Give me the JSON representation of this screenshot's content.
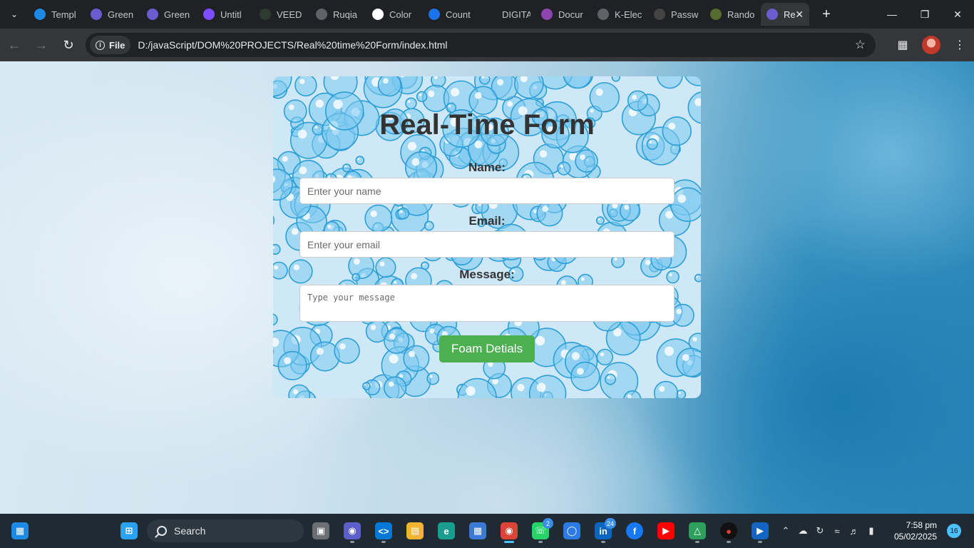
{
  "browser": {
    "tabs": [
      {
        "label": "Templ",
        "icon": "canva-icon",
        "color": "#1e88e5"
      },
      {
        "label": "Green",
        "icon": "doc-icon",
        "color": "#6d5bd0"
      },
      {
        "label": "Green",
        "icon": "doc-icon",
        "color": "#6d5bd0"
      },
      {
        "label": "Untitl",
        "icon": "app-icon",
        "color": "#7c4dff"
      },
      {
        "label": "VEED",
        "icon": "veed-icon",
        "color": "#2e3b2f"
      },
      {
        "label": "Ruqia",
        "icon": "globe-icon",
        "color": "#5f6368"
      },
      {
        "label": "Color",
        "icon": "color-icon",
        "color": "#ffffff"
      },
      {
        "label": "Count",
        "icon": "count-icon",
        "color": "#1a73e8"
      },
      {
        "label": "DIGITA",
        "icon": "terminal-icon",
        "color": "#202124"
      },
      {
        "label": "Docur",
        "icon": "doc-icon",
        "color": "#8e44ad"
      },
      {
        "label": "K-Elec",
        "icon": "globe-icon",
        "color": "#5f6368"
      },
      {
        "label": "Passw",
        "icon": "key-icon",
        "color": "#444"
      },
      {
        "label": "Rando",
        "icon": "image-icon",
        "color": "#556b2f"
      }
    ],
    "active_tab": {
      "label": "Re",
      "icon": "doc-icon",
      "color": "#6d5bd0"
    },
    "url_chip": "File",
    "url": "D:/javaScript/DOM%20PROJECTS/Real%20time%20Form/index.html"
  },
  "form": {
    "title": "Real-Time Form",
    "name_label": "Name:",
    "name_placeholder": "Enter your name",
    "email_label": "Email:",
    "email_placeholder": "Enter your email",
    "message_label": "Message:",
    "message_placeholder": "Type your message",
    "submit_label": "Foam Detials",
    "submit_color": "#4caf50"
  },
  "taskbar": {
    "search_label": "Search",
    "whatsapp_badge": "2",
    "linkedin_badge": "24",
    "time": "7:58 pm",
    "date": "05/02/2025",
    "notifications": "16"
  }
}
